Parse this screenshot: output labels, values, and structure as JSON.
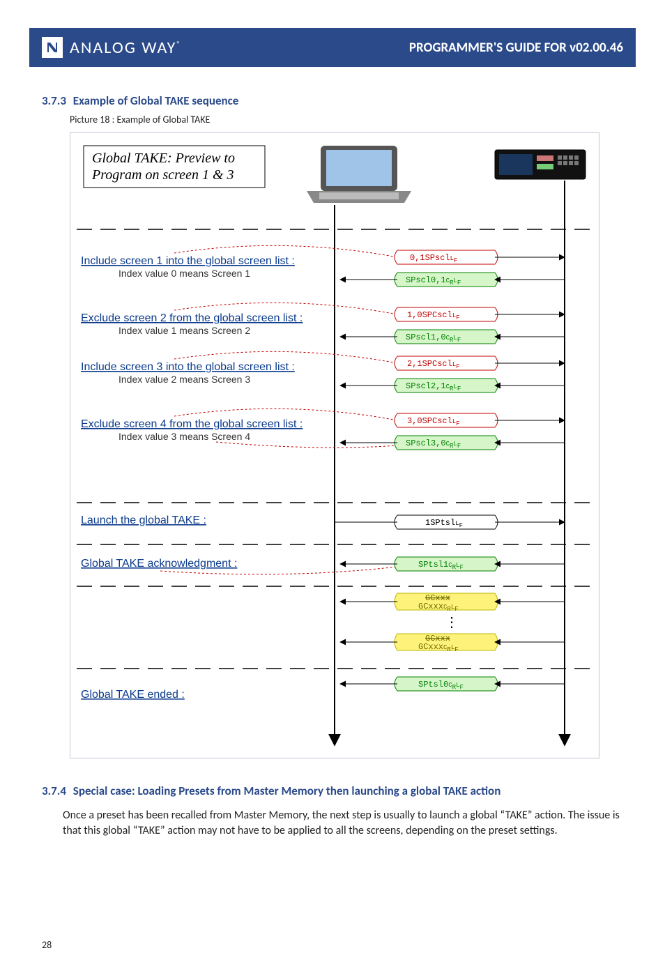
{
  "header": {
    "brand": "ANALOG WAY",
    "reg": "®",
    "title": "PROGRAMMER'S GUIDE FOR v02.00.46"
  },
  "section1": {
    "num": "3.7.3",
    "title": "Example of Global TAKE sequence",
    "caption": "Picture 18 : Example of Global TAKE"
  },
  "figure": {
    "titlebox": {
      "line1": "Global TAKE: Preview to",
      "line2": "Program on screen 1 & 3"
    },
    "rows": [
      {
        "label": "Include screen 1 into the global screen list :",
        "sub": "Index value 0 means Screen 1",
        "send": "0,1SPscl",
        "recv": "SPscl0,1"
      },
      {
        "label": "Exclude screen 2 from the global screen list :",
        "sub": "Index value 1 means Screen 2",
        "send": "1,0SPCscl",
        "recv": "SPscl1,0"
      },
      {
        "label": "Include screen 3 into the global screen list :",
        "sub": "Index value 2 means Screen 3",
        "send": "2,1SPCscl",
        "recv": "SPscl2,1"
      },
      {
        "label": "Exclude screen 4 from the global screen list :",
        "sub": "Index value 3 means Screen 4",
        "send": "3,0SPCscl",
        "recv": "SPscl3,0"
      }
    ],
    "launch": {
      "label": "Launch the global TAKE :",
      "send": "1SPtsl"
    },
    "ack": {
      "label": "Global TAKE acknowledgment :",
      "recv": "SPtsl1"
    },
    "updates": [
      {
        "strike": "GCxxx",
        "line": "GCxxx"
      },
      {
        "strike": "GCxxx",
        "line": "GCxxx"
      }
    ],
    "ended": {
      "label": "Global TAKE ended :",
      "recv": "SPtsl0"
    }
  },
  "section2": {
    "num": "3.7.4",
    "title": "Special case: Loading Presets from Master Memory then launching a global TAKE action",
    "para": "Once a preset has been recalled from Master Memory, the next step is usually to launch a global “TAKE” action. The issue is that this global “TAKE” action may not have to be applied to all the screens, depending on the preset settings."
  },
  "page_number": "28"
}
